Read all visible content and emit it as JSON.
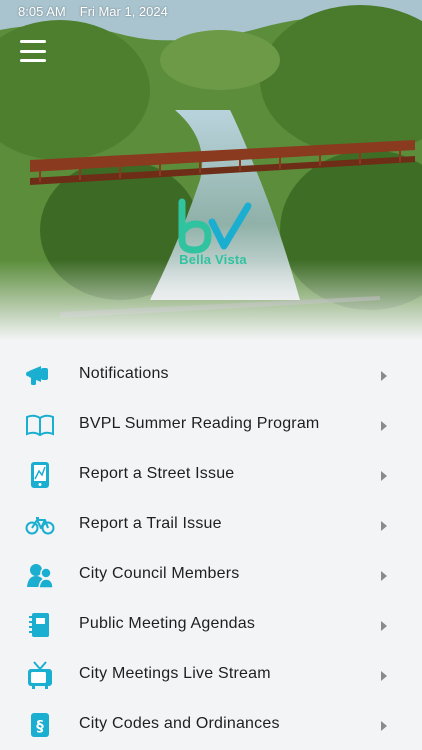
{
  "status_bar": {
    "time": "8:05 AM",
    "date": "Fri Mar 1, 2024"
  },
  "logo": {
    "text": "Bella Vista"
  },
  "colors": {
    "accent": "#1aaed0",
    "logo_teal": "#2fc3a0",
    "background": "#f3f4f6",
    "text": "#1f1f1f",
    "chevron": "#8a8a8a"
  },
  "menu": [
    {
      "label": "Notifications",
      "icon": "megaphone-icon"
    },
    {
      "label": "BVPL Summer Reading Program",
      "icon": "open-book-icon"
    },
    {
      "label": "Report a Street Issue",
      "icon": "map-phone-icon"
    },
    {
      "label": "Report a Trail Issue",
      "icon": "bicycle-icon"
    },
    {
      "label": "City Council Members",
      "icon": "people-icon"
    },
    {
      "label": "Public Meeting Agendas",
      "icon": "notebook-icon"
    },
    {
      "label": "City Meetings Live Stream",
      "icon": "tv-icon"
    },
    {
      "label": "City Codes and Ordinances",
      "icon": "section-book-icon"
    }
  ]
}
